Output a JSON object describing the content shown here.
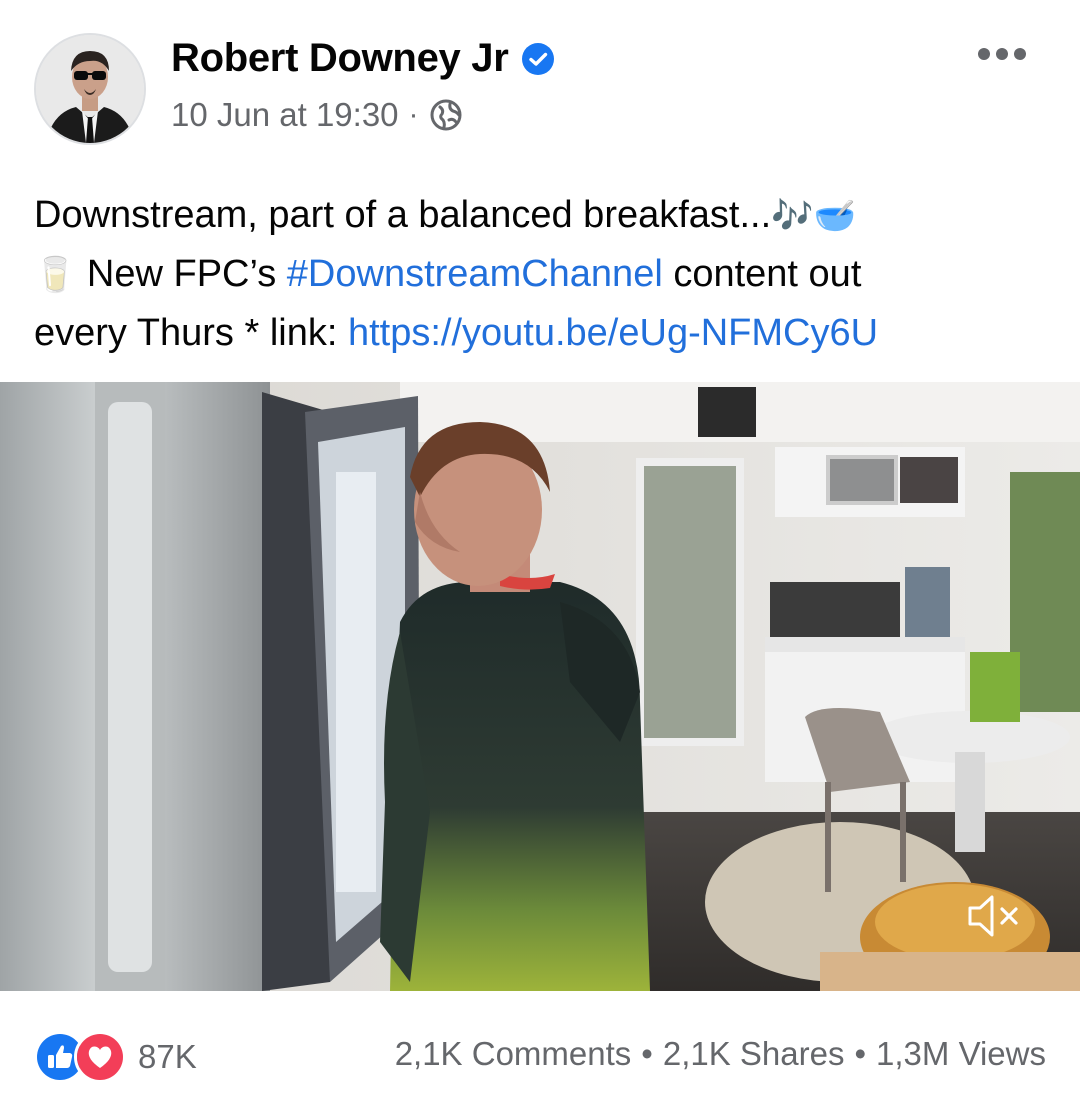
{
  "post": {
    "author": "Robert Downey Jr",
    "verified": true,
    "timestamp": "10 Jun at 19:30",
    "separator": "·",
    "privacy_icon": "globe-icon",
    "text_line1": "Downstream, part of a balanced breakfast...",
    "emoji_music": "🎶",
    "emoji_bowl": "🥣",
    "emoji_milk": "🥛",
    "text_line2_pre": " New FPC’s ",
    "hashtag": "#DownstreamChannel",
    "text_line2_post": " content out",
    "text_line3_pre": "every Thurs * link: ",
    "link": "https://youtu.be/eUg-NFMCy6U"
  },
  "video": {
    "mute_icon": "mute-icon"
  },
  "footer": {
    "reaction_count": "87K",
    "comments": "2,1K Comments",
    "shares": "2,1K Shares",
    "views": "1,3M Views",
    "dot": "•"
  },
  "colors": {
    "link": "#216fdb",
    "secondary_text": "#65676b",
    "verified_blue": "#1877f2",
    "love_red": "#f33e58"
  }
}
